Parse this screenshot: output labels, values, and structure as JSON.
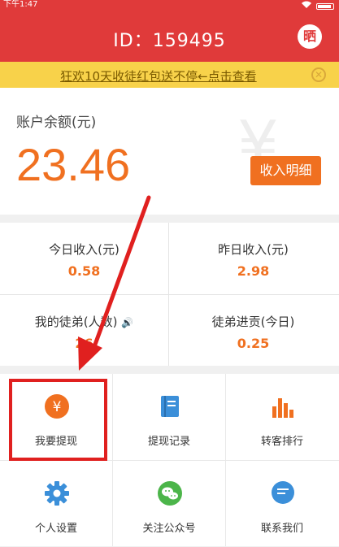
{
  "status_bar": {
    "time": "下午1:47"
  },
  "header": {
    "title": "ID：159495",
    "share_label": "晒"
  },
  "banner": {
    "text": "狂欢10天收徒红包送不停←点击查看"
  },
  "balance": {
    "label": "账户余额(元)",
    "amount": "23.46",
    "bg_symbol": "¥",
    "detail_button": "收入明细"
  },
  "stats": [
    {
      "label": "今日收入(元)",
      "value": "0.58"
    },
    {
      "label": "昨日收入(元)",
      "value": "2.98"
    },
    {
      "label": "我的徒弟(人数)",
      "value": "26"
    },
    {
      "label": "徒弟进贡(今日)",
      "value": "0.25"
    }
  ],
  "menu": [
    {
      "label": "我要提现",
      "icon": "yen-circle-icon"
    },
    {
      "label": "提现记录",
      "icon": "book-icon"
    },
    {
      "label": "转客排行",
      "icon": "bar-chart-icon"
    },
    {
      "label": "个人设置",
      "icon": "gear-icon"
    },
    {
      "label": "关注公众号",
      "icon": "wechat-icon"
    },
    {
      "label": "联系我们",
      "icon": "message-icon"
    }
  ],
  "colors": {
    "brand_red": "#e03a3a",
    "accent_orange": "#f07020",
    "banner_yellow": "#f8d24a",
    "icon_blue": "#3b8fd9",
    "icon_green": "#4cb54a",
    "highlight_red": "#e0201f"
  }
}
